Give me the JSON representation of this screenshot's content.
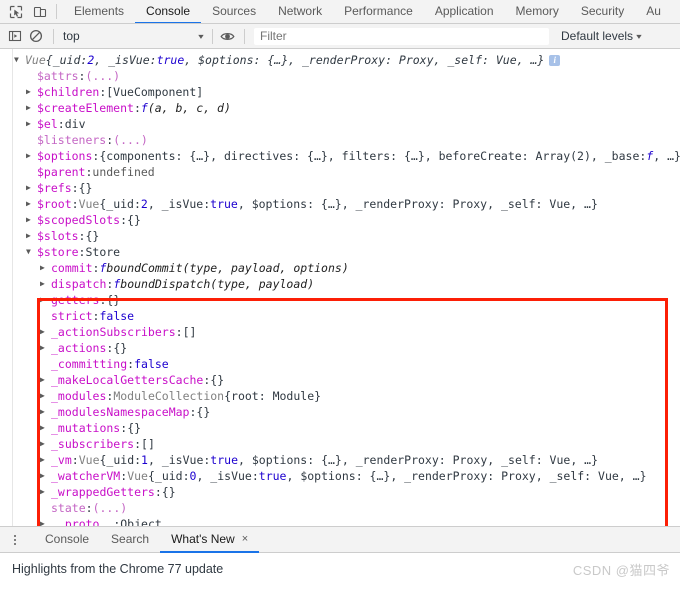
{
  "toolbar": {
    "inspect_icon": "inspect-cursor-icon",
    "device_icon": "device-toolbar-icon",
    "tabs": [
      {
        "label": "Elements",
        "selected": false
      },
      {
        "label": "Console",
        "selected": true
      },
      {
        "label": "Sources",
        "selected": false
      },
      {
        "label": "Network",
        "selected": false
      },
      {
        "label": "Performance",
        "selected": false
      },
      {
        "label": "Application",
        "selected": false
      },
      {
        "label": "Memory",
        "selected": false
      },
      {
        "label": "Security",
        "selected": false
      },
      {
        "label": "Au",
        "selected": false
      }
    ]
  },
  "console_toolbar": {
    "sidebar_icon": "console-sidebar-icon",
    "clear_icon": "clear-console-icon",
    "eye_icon": "live-expression-icon",
    "context": "top",
    "caret": "▾",
    "filter_placeholder": "Filter",
    "filter_value": "",
    "levels_label": "Default levels",
    "levels_caret": "▾"
  },
  "console_lines": [
    {
      "indent": 0,
      "tri": "open",
      "segments": [
        {
          "t": "Vue ",
          "c": "k-ctor k-italic"
        },
        {
          "t": "{_uid: ",
          "c": "k-plain k-italic"
        },
        {
          "t": "2",
          "c": "k-num k-italic"
        },
        {
          "t": ", _isVue: ",
          "c": "k-plain k-italic"
        },
        {
          "t": "true",
          "c": "k-bool k-italic"
        },
        {
          "t": ", $options: {…}, _renderProxy: Proxy, _self: Vue, …}",
          "c": "k-plain k-italic"
        }
      ],
      "badge": "i"
    },
    {
      "indent": 1,
      "tri": "none",
      "segments": [
        {
          "t": "$attrs",
          "c": "k-propd"
        },
        {
          "t": ": ",
          "c": "k-plain"
        },
        {
          "t": "(...)",
          "c": "k-propd"
        }
      ]
    },
    {
      "indent": 1,
      "tri": "closed",
      "segments": [
        {
          "t": "$children",
          "c": "k-prop"
        },
        {
          "t": ": ",
          "c": "k-plain"
        },
        {
          "t": "[VueComponent]",
          "c": "k-plain"
        }
      ]
    },
    {
      "indent": 1,
      "tri": "closed",
      "segments": [
        {
          "t": "$createElement",
          "c": "k-prop"
        },
        {
          "t": ": ",
          "c": "k-plain"
        },
        {
          "t": "f",
          "c": "k-fsym"
        },
        {
          "t": " (a, b, c, d)",
          "c": "k-fn"
        }
      ]
    },
    {
      "indent": 1,
      "tri": "closed",
      "segments": [
        {
          "t": "$el",
          "c": "k-prop"
        },
        {
          "t": ": ",
          "c": "k-plain"
        },
        {
          "t": "div",
          "c": "k-plain"
        }
      ]
    },
    {
      "indent": 1,
      "tri": "none",
      "segments": [
        {
          "t": "$listeners",
          "c": "k-propd"
        },
        {
          "t": ": ",
          "c": "k-plain"
        },
        {
          "t": "(...)",
          "c": "k-propd"
        }
      ]
    },
    {
      "indent": 1,
      "tri": "closed",
      "segments": [
        {
          "t": "$options",
          "c": "k-prop"
        },
        {
          "t": ": ",
          "c": "k-plain"
        },
        {
          "t": "{components: {…}, directives: {…}, filters: {…}, beforeCreate: Array(2), _base: ",
          "c": "k-plain"
        },
        {
          "t": "f",
          "c": "k-fsym"
        },
        {
          "t": ", …}",
          "c": "k-plain"
        }
      ]
    },
    {
      "indent": 1,
      "tri": "none",
      "segments": [
        {
          "t": "$parent",
          "c": "k-prop"
        },
        {
          "t": ": ",
          "c": "k-plain"
        },
        {
          "t": "undefined",
          "c": "k-dim"
        }
      ]
    },
    {
      "indent": 1,
      "tri": "closed",
      "segments": [
        {
          "t": "$refs",
          "c": "k-prop"
        },
        {
          "t": ": ",
          "c": "k-plain"
        },
        {
          "t": "{}",
          "c": "k-plain"
        }
      ]
    },
    {
      "indent": 1,
      "tri": "closed",
      "segments": [
        {
          "t": "$root",
          "c": "k-prop"
        },
        {
          "t": ": ",
          "c": "k-plain"
        },
        {
          "t": "Vue ",
          "c": "k-ctor"
        },
        {
          "t": "{_uid: ",
          "c": "k-plain"
        },
        {
          "t": "2",
          "c": "k-num"
        },
        {
          "t": ", _isVue: ",
          "c": "k-plain"
        },
        {
          "t": "true",
          "c": "k-bool"
        },
        {
          "t": ", $options: {…}, _renderProxy: Proxy, _self: Vue, …}",
          "c": "k-plain"
        }
      ]
    },
    {
      "indent": 1,
      "tri": "closed",
      "segments": [
        {
          "t": "$scopedSlots",
          "c": "k-prop"
        },
        {
          "t": ": ",
          "c": "k-plain"
        },
        {
          "t": "{}",
          "c": "k-plain"
        }
      ]
    },
    {
      "indent": 1,
      "tri": "closed",
      "segments": [
        {
          "t": "$slots",
          "c": "k-prop"
        },
        {
          "t": ": ",
          "c": "k-plain"
        },
        {
          "t": "{}",
          "c": "k-plain"
        }
      ]
    },
    {
      "indent": 1,
      "tri": "open",
      "segments": [
        {
          "t": "$store",
          "c": "k-prop"
        },
        {
          "t": ": ",
          "c": "k-plain"
        },
        {
          "t": "Store",
          "c": "k-plain"
        }
      ]
    },
    {
      "indent": 2,
      "tri": "closed",
      "segments": [
        {
          "t": "commit",
          "c": "k-prop"
        },
        {
          "t": ": ",
          "c": "k-plain"
        },
        {
          "t": "f",
          "c": "k-fsym"
        },
        {
          "t": " boundCommit(type, payload, options)",
          "c": "k-fn"
        }
      ]
    },
    {
      "indent": 2,
      "tri": "closed",
      "segments": [
        {
          "t": "dispatch",
          "c": "k-prop"
        },
        {
          "t": ": ",
          "c": "k-plain"
        },
        {
          "t": "f",
          "c": "k-fsym"
        },
        {
          "t": " boundDispatch(type, payload)",
          "c": "k-fn"
        }
      ]
    },
    {
      "indent": 2,
      "tri": "closed",
      "segments": [
        {
          "t": "getters",
          "c": "k-prop"
        },
        {
          "t": ": ",
          "c": "k-plain"
        },
        {
          "t": "{}",
          "c": "k-plain"
        }
      ]
    },
    {
      "indent": 2,
      "tri": "none",
      "segments": [
        {
          "t": "strict",
          "c": "k-prop"
        },
        {
          "t": ": ",
          "c": "k-plain"
        },
        {
          "t": "false",
          "c": "k-bool"
        }
      ]
    },
    {
      "indent": 2,
      "tri": "closed",
      "segments": [
        {
          "t": "_actionSubscribers",
          "c": "k-prop"
        },
        {
          "t": ": ",
          "c": "k-plain"
        },
        {
          "t": "[]",
          "c": "k-plain"
        }
      ]
    },
    {
      "indent": 2,
      "tri": "closed",
      "segments": [
        {
          "t": "_actions",
          "c": "k-prop"
        },
        {
          "t": ": ",
          "c": "k-plain"
        },
        {
          "t": "{}",
          "c": "k-plain"
        }
      ]
    },
    {
      "indent": 2,
      "tri": "none",
      "segments": [
        {
          "t": "_committing",
          "c": "k-prop"
        },
        {
          "t": ": ",
          "c": "k-plain"
        },
        {
          "t": "false",
          "c": "k-bool"
        }
      ]
    },
    {
      "indent": 2,
      "tri": "closed",
      "segments": [
        {
          "t": "_makeLocalGettersCache",
          "c": "k-prop"
        },
        {
          "t": ": ",
          "c": "k-plain"
        },
        {
          "t": "{}",
          "c": "k-plain"
        }
      ]
    },
    {
      "indent": 2,
      "tri": "closed",
      "segments": [
        {
          "t": "_modules",
          "c": "k-prop"
        },
        {
          "t": ": ",
          "c": "k-plain"
        },
        {
          "t": "ModuleCollection ",
          "c": "k-ctor"
        },
        {
          "t": "{root: Module}",
          "c": "k-plain"
        }
      ]
    },
    {
      "indent": 2,
      "tri": "closed",
      "segments": [
        {
          "t": "_modulesNamespaceMap",
          "c": "k-prop"
        },
        {
          "t": ": ",
          "c": "k-plain"
        },
        {
          "t": "{}",
          "c": "k-plain"
        }
      ]
    },
    {
      "indent": 2,
      "tri": "closed",
      "segments": [
        {
          "t": "_mutations",
          "c": "k-prop"
        },
        {
          "t": ": ",
          "c": "k-plain"
        },
        {
          "t": "{}",
          "c": "k-plain"
        }
      ]
    },
    {
      "indent": 2,
      "tri": "closed",
      "segments": [
        {
          "t": "_subscribers",
          "c": "k-prop"
        },
        {
          "t": ": ",
          "c": "k-plain"
        },
        {
          "t": "[]",
          "c": "k-plain"
        }
      ]
    },
    {
      "indent": 2,
      "tri": "closed",
      "segments": [
        {
          "t": "_vm",
          "c": "k-prop"
        },
        {
          "t": ": ",
          "c": "k-plain"
        },
        {
          "t": "Vue ",
          "c": "k-ctor"
        },
        {
          "t": "{_uid: ",
          "c": "k-plain"
        },
        {
          "t": "1",
          "c": "k-num"
        },
        {
          "t": ", _isVue: ",
          "c": "k-plain"
        },
        {
          "t": "true",
          "c": "k-bool"
        },
        {
          "t": ", $options: {…}, _renderProxy: Proxy, _self: Vue, …}",
          "c": "k-plain"
        }
      ]
    },
    {
      "indent": 2,
      "tri": "closed",
      "segments": [
        {
          "t": "_watcherVM",
          "c": "k-prop"
        },
        {
          "t": ": ",
          "c": "k-plain"
        },
        {
          "t": "Vue ",
          "c": "k-ctor"
        },
        {
          "t": "{_uid: ",
          "c": "k-plain"
        },
        {
          "t": "0",
          "c": "k-num"
        },
        {
          "t": ", _isVue: ",
          "c": "k-plain"
        },
        {
          "t": "true",
          "c": "k-bool"
        },
        {
          "t": ", $options: {…}, _renderProxy: Proxy, _self: Vue, …}",
          "c": "k-plain"
        }
      ]
    },
    {
      "indent": 2,
      "tri": "closed",
      "segments": [
        {
          "t": "_wrappedGetters",
          "c": "k-prop"
        },
        {
          "t": ": ",
          "c": "k-plain"
        },
        {
          "t": "{}",
          "c": "k-plain"
        }
      ]
    },
    {
      "indent": 2,
      "tri": "none",
      "segments": [
        {
          "t": "state",
          "c": "k-propd"
        },
        {
          "t": ": ",
          "c": "k-plain"
        },
        {
          "t": "(...)",
          "c": "k-propd"
        }
      ]
    },
    {
      "indent": 2,
      "tri": "closed",
      "segments": [
        {
          "t": "__proto__",
          "c": "k-prop"
        },
        {
          "t": ": ",
          "c": "k-plain"
        },
        {
          "t": "Object",
          "c": "k-plain"
        }
      ]
    }
  ],
  "annotation": {
    "box_color": "#fc1f06"
  },
  "drawer": {
    "menu_icon": "more-options-icon",
    "tabs": [
      {
        "label": "Console",
        "selected": false,
        "closable": false
      },
      {
        "label": "Search",
        "selected": false,
        "closable": false
      },
      {
        "label": "What's New",
        "selected": true,
        "closable": true
      }
    ],
    "close_icon": "×",
    "body_text": "Highlights from the Chrome 77 update"
  },
  "watermark": {
    "text": "CSDN @猫四爷"
  }
}
